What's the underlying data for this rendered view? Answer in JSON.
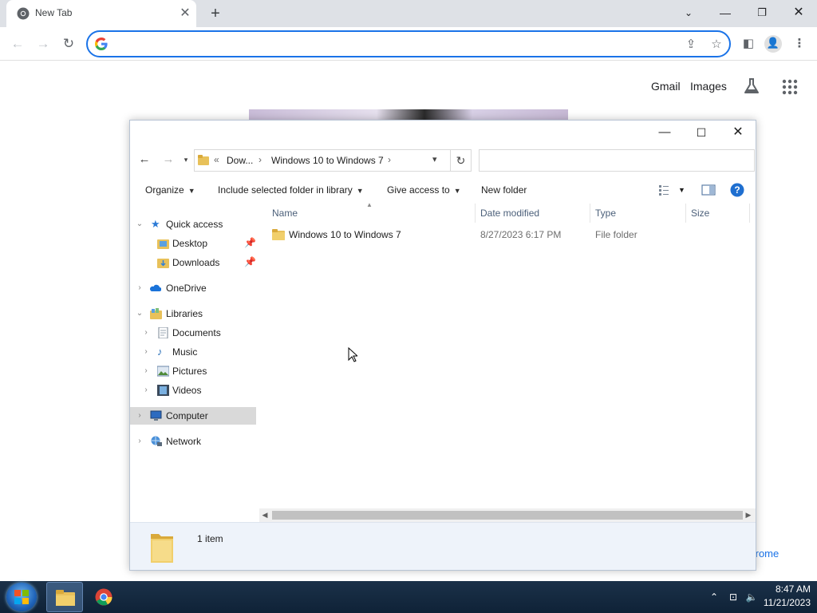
{
  "chrome": {
    "tab_title": "New Tab",
    "omnibox_value": "",
    "ntp_links": {
      "gmail": "Gmail",
      "images": "Images"
    },
    "customize_label": "Chrome"
  },
  "explorer": {
    "breadcrumb": {
      "chevrons": "«",
      "part1": "Dow...",
      "part2": "Windows 10 to Windows 7",
      "sep": "›"
    },
    "search_placeholder": "",
    "commands": {
      "organize": "Organize",
      "include": "Include selected folder in library",
      "share": "Give access to",
      "new_folder": "New folder"
    },
    "nav": {
      "quick_access": "Quick access",
      "desktop": "Desktop",
      "downloads": "Downloads",
      "onedrive": "OneDrive",
      "libraries": "Libraries",
      "documents": "Documents",
      "music": "Music",
      "pictures": "Pictures",
      "videos": "Videos",
      "computer": "Computer",
      "network": "Network"
    },
    "columns": {
      "name": "Name",
      "date": "Date modified",
      "type": "Type",
      "size": "Size"
    },
    "files": [
      {
        "name": "Windows 10 to Windows 7",
        "date": "8/27/2023 6:17 PM",
        "type": "File folder",
        "size": ""
      }
    ],
    "status": "1 item"
  },
  "taskbar": {
    "time": "8:47 AM",
    "date": "11/21/2023"
  },
  "colors": {
    "accent": "#1a73e8",
    "folder": "#e8c15a",
    "taskbar": "#13283f"
  }
}
